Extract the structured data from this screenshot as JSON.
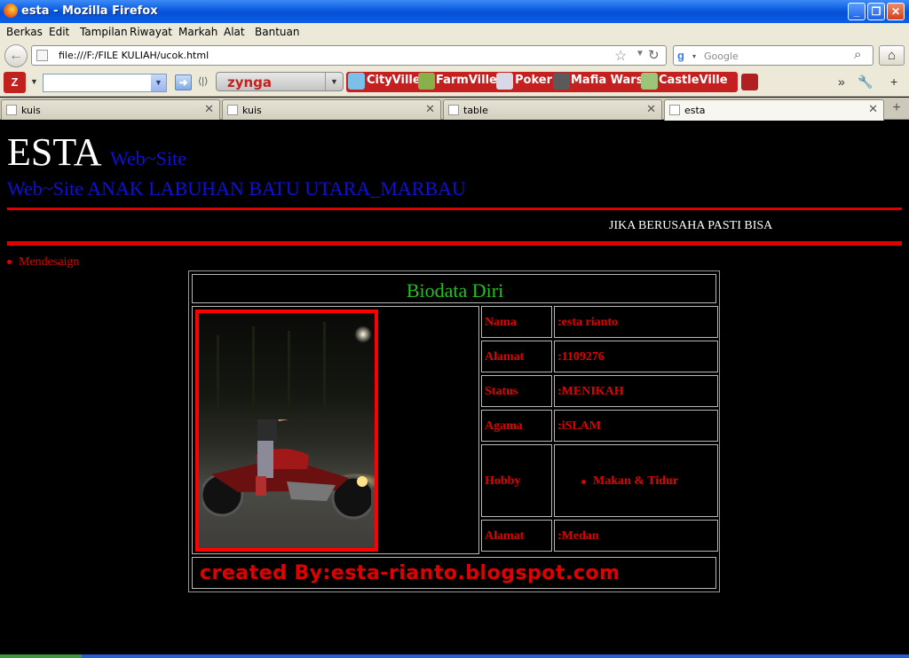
{
  "window": {
    "title": "esta - Mozilla Firefox"
  },
  "menu": [
    "Berkas",
    "Edit",
    "Tampilan",
    "Riwayat",
    "Markah",
    "Alat",
    "Bantuan"
  ],
  "nav": {
    "url": "file:///F:/FILE KULIAH/ucok.html",
    "search_placeholder": "Google"
  },
  "toolbar": {
    "zynga_label": "zynga",
    "games": [
      "CityVille",
      "FarmVille",
      "Poker",
      "Mafia Wars",
      "CastleVille"
    ],
    "overflow": "»"
  },
  "tabs": [
    {
      "label": "kuis",
      "active": false
    },
    {
      "label": "kuis",
      "active": false
    },
    {
      "label": "table",
      "active": false
    },
    {
      "label": "esta",
      "active": true
    }
  ],
  "page": {
    "brand_big": "ESTA",
    "brand_small": "Web~Site",
    "subtitle": "Web~Site ANAK LABUHAN BATU UTARA_MARBAU",
    "motto": "JIKA BERUSAHA PASTI BISA",
    "nav_items": [
      "Mendesaign"
    ],
    "biodata": {
      "title": "Biodata Diri",
      "rows": [
        {
          "label": "Nama",
          "value": ":esta rianto"
        },
        {
          "label": "Alamat",
          "value": ":1109276"
        },
        {
          "label": "Status",
          "value": ":MENIKAH"
        },
        {
          "label": "Agama",
          "value": ":iSLAM"
        },
        {
          "label": "Hobby",
          "value": "Makan & Tidur"
        },
        {
          "label": "Alamat",
          "value": ":Medan"
        }
      ],
      "footer": "created By:esta-rianto.blogspot.com"
    }
  },
  "colors": {
    "heading_blue": "#1010d8",
    "accent_red": "#e00000",
    "title_green": "#22c022"
  }
}
